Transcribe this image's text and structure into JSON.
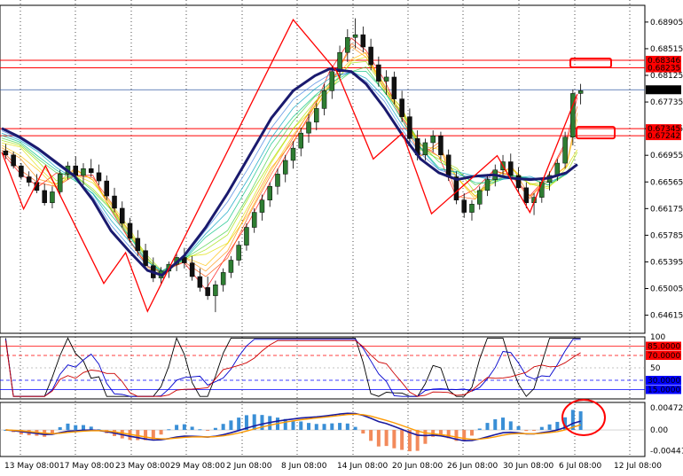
{
  "chart_data": {
    "type": "candlestick",
    "symbol": "",
    "x_labels": [
      "13 May 08:00",
      "17 May 08:00",
      "23 May 08:00",
      "29 May 08:00",
      "2 Jun 08:00",
      "8 Jun 08:00",
      "14 Jun 08:00",
      "20 Jun 08:00",
      "26 Jun 08:00",
      "30 Jun 08:00",
      "6 Jul 08:00",
      "12 Jul 08:00"
    ],
    "main": {
      "ylim": [
        0.6435,
        0.6915
      ],
      "y_ticks": [
        "0.68905",
        "0.68515",
        "0.68125",
        "0.67735",
        "0.67345",
        "0.66955",
        "0.66565",
        "0.66175",
        "0.65785",
        "0.65395",
        "0.65005",
        "0.64615"
      ],
      "current_price": "0.67914",
      "zones": [
        {
          "upper": "0.68346",
          "lower": "0.68235"
        },
        {
          "upper": "0.67345",
          "lower": "0.67242"
        }
      ],
      "zigzag": [
        [
          0,
          0.67
        ],
        [
          6,
          0.6617
        ],
        [
          12,
          0.668
        ],
        [
          28,
          0.6508
        ],
        [
          34,
          0.6553
        ],
        [
          40,
          0.6467
        ],
        [
          80,
          0.6894
        ],
        [
          92,
          0.6818
        ],
        [
          102,
          0.669
        ],
        [
          110,
          0.6728
        ],
        [
          118,
          0.661
        ],
        [
          136,
          0.6695
        ],
        [
          145,
          0.6612
        ],
        [
          158,
          0.6785
        ]
      ],
      "ma_thick": [
        [
          0,
          0.6735
        ],
        [
          5,
          0.6722
        ],
        [
          10,
          0.6705
        ],
        [
          15,
          0.6685
        ],
        [
          20,
          0.6665
        ],
        [
          25,
          0.663
        ],
        [
          30,
          0.6585
        ],
        [
          35,
          0.6555
        ],
        [
          40,
          0.6527
        ],
        [
          44,
          0.652
        ],
        [
          50,
          0.6548
        ],
        [
          56,
          0.659
        ],
        [
          62,
          0.664
        ],
        [
          68,
          0.6695
        ],
        [
          74,
          0.675
        ],
        [
          80,
          0.679
        ],
        [
          86,
          0.6812
        ],
        [
          90,
          0.6822
        ],
        [
          96,
          0.6818
        ],
        [
          100,
          0.68
        ],
        [
          105,
          0.6765
        ],
        [
          110,
          0.6725
        ],
        [
          115,
          0.669
        ],
        [
          120,
          0.667
        ],
        [
          125,
          0.666
        ],
        [
          130,
          0.6665
        ],
        [
          135,
          0.6667
        ],
        [
          140,
          0.6662
        ],
        [
          145,
          0.666
        ],
        [
          150,
          0.6662
        ],
        [
          155,
          0.667
        ],
        [
          158,
          0.6682
        ]
      ],
      "candles": [
        [
          0.6702,
          0.6712,
          0.669,
          0.6696
        ],
        [
          0.6696,
          0.6701,
          0.6676,
          0.668
        ],
        [
          0.668,
          0.6684,
          0.666,
          0.6664
        ],
        [
          0.6664,
          0.6672,
          0.665,
          0.6656
        ],
        [
          0.6656,
          0.6668,
          0.664,
          0.6644
        ],
        [
          0.6644,
          0.6654,
          0.6622,
          0.6626
        ],
        [
          0.6626,
          0.665,
          0.6618,
          0.6642
        ],
        [
          0.6642,
          0.6674,
          0.6636,
          0.6668
        ],
        [
          0.6668,
          0.6686,
          0.666,
          0.668
        ],
        [
          0.668,
          0.6694,
          0.6662,
          0.6666
        ],
        [
          0.6666,
          0.6684,
          0.6652,
          0.6676
        ],
        [
          0.6676,
          0.669,
          0.6664,
          0.667
        ],
        [
          0.667,
          0.6682,
          0.6652,
          0.6658
        ],
        [
          0.6658,
          0.6666,
          0.663,
          0.6636
        ],
        [
          0.6636,
          0.6648,
          0.6612,
          0.6618
        ],
        [
          0.6618,
          0.6628,
          0.659,
          0.6596
        ],
        [
          0.6596,
          0.6604,
          0.6568,
          0.6574
        ],
        [
          0.6574,
          0.6586,
          0.6548,
          0.6556
        ],
        [
          0.6556,
          0.6566,
          0.6528,
          0.6534
        ],
        [
          0.6534,
          0.6546,
          0.651,
          0.6516
        ],
        [
          0.6516,
          0.6532,
          0.6506,
          0.6526
        ],
        [
          0.6526,
          0.654,
          0.6516,
          0.6536
        ],
        [
          0.6536,
          0.6552,
          0.6526,
          0.6546
        ],
        [
          0.6546,
          0.656,
          0.653,
          0.6538
        ],
        [
          0.6538,
          0.6548,
          0.6512,
          0.6518
        ],
        [
          0.6518,
          0.653,
          0.6496,
          0.6502
        ],
        [
          0.6502,
          0.6518,
          0.6484,
          0.649
        ],
        [
          0.649,
          0.6512,
          0.6466,
          0.6506
        ],
        [
          0.6506,
          0.653,
          0.6496,
          0.6524
        ],
        [
          0.6524,
          0.6548,
          0.6516,
          0.6542
        ],
        [
          0.6542,
          0.657,
          0.6534,
          0.6564
        ],
        [
          0.6564,
          0.6596,
          0.6556,
          0.659
        ],
        [
          0.659,
          0.6618,
          0.6582,
          0.6612
        ],
        [
          0.6612,
          0.6638,
          0.66,
          0.663
        ],
        [
          0.663,
          0.6656,
          0.662,
          0.665
        ],
        [
          0.665,
          0.6676,
          0.6638,
          0.6668
        ],
        [
          0.6668,
          0.6696,
          0.6656,
          0.6688
        ],
        [
          0.6688,
          0.6716,
          0.6676,
          0.6706
        ],
        [
          0.6706,
          0.6736,
          0.6694,
          0.6728
        ],
        [
          0.6728,
          0.6756,
          0.6714,
          0.6744
        ],
        [
          0.6744,
          0.6772,
          0.6732,
          0.6764
        ],
        [
          0.6764,
          0.68,
          0.6754,
          0.679
        ],
        [
          0.679,
          0.6826,
          0.6778,
          0.6818
        ],
        [
          0.6818,
          0.6856,
          0.6806,
          0.6846
        ],
        [
          0.6846,
          0.688,
          0.6832,
          0.6868
        ],
        [
          0.6868,
          0.6896,
          0.6852,
          0.6872
        ],
        [
          0.6872,
          0.6884,
          0.6846,
          0.6854
        ],
        [
          0.6854,
          0.6866,
          0.682,
          0.6828
        ],
        [
          0.6828,
          0.684,
          0.6796,
          0.6804
        ],
        [
          0.6804,
          0.682,
          0.6784,
          0.681
        ],
        [
          0.681,
          0.6818,
          0.677,
          0.6778
        ],
        [
          0.6778,
          0.679,
          0.6744,
          0.6752
        ],
        [
          0.6752,
          0.6764,
          0.6712,
          0.672
        ],
        [
          0.672,
          0.6732,
          0.6688,
          0.6696
        ],
        [
          0.6696,
          0.672,
          0.6688,
          0.6714
        ],
        [
          0.6714,
          0.6732,
          0.67,
          0.6724
        ],
        [
          0.6724,
          0.673,
          0.669,
          0.6696
        ],
        [
          0.6696,
          0.6704,
          0.6658,
          0.6664
        ],
        [
          0.6664,
          0.6672,
          0.6624,
          0.663
        ],
        [
          0.663,
          0.664,
          0.6604,
          0.6612
        ],
        [
          0.6612,
          0.663,
          0.66,
          0.6624
        ],
        [
          0.6624,
          0.665,
          0.6616,
          0.6644
        ],
        [
          0.6644,
          0.6668,
          0.6636,
          0.666
        ],
        [
          0.666,
          0.6682,
          0.665,
          0.6674
        ],
        [
          0.6674,
          0.6696,
          0.6664,
          0.6686
        ],
        [
          0.6686,
          0.6698,
          0.666,
          0.6666
        ],
        [
          0.6666,
          0.6678,
          0.664,
          0.6648
        ],
        [
          0.6648,
          0.6656,
          0.6618,
          0.6626
        ],
        [
          0.6626,
          0.664,
          0.6608,
          0.6634
        ],
        [
          0.6634,
          0.6662,
          0.6626,
          0.6656
        ],
        [
          0.6656,
          0.6672,
          0.6644,
          0.6666
        ],
        [
          0.6666,
          0.669,
          0.6658,
          0.6684
        ],
        [
          0.6684,
          0.673,
          0.6676,
          0.6722
        ],
        [
          0.6722,
          0.6792,
          0.671,
          0.6786
        ],
        [
          0.6786,
          0.68,
          0.677,
          0.679
        ]
      ]
    },
    "rsi": {
      "ylim": [
        0,
        100
      ],
      "y_ticks_right": [
        "100",
        "50"
      ],
      "levels": [
        "85.0000",
        "70.0000",
        "30.0000",
        "15.0000"
      ]
    },
    "macd": {
      "y_ticks": [
        "0.004723",
        "0.00",
        "-0.004415"
      ],
      "ylim": [
        -0.0056,
        0.0058
      ]
    }
  }
}
